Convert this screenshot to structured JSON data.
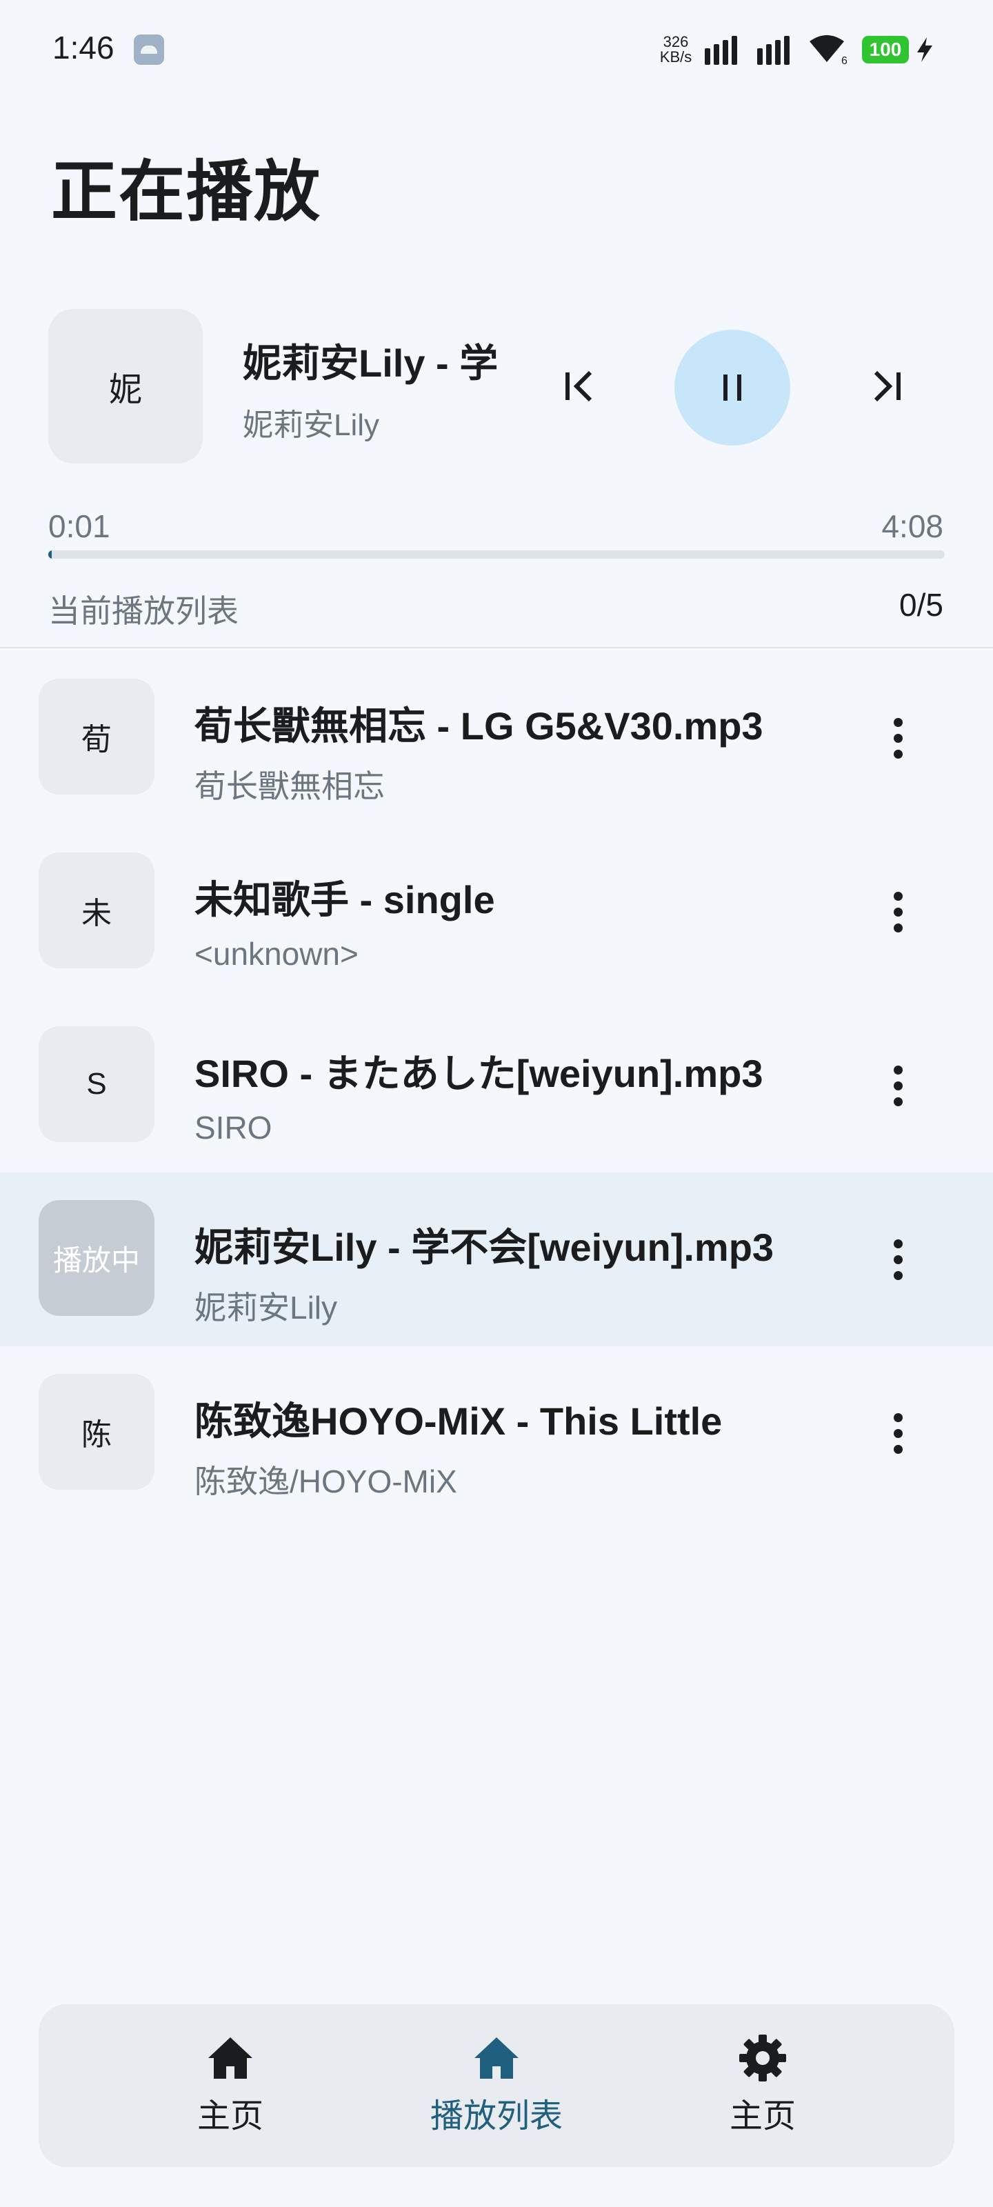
{
  "status_bar": {
    "time": "1:46",
    "net_speed_value": "326",
    "net_speed_unit": "KB/s",
    "wifi_badge": "6",
    "battery": "100"
  },
  "page": {
    "title": "正在播放"
  },
  "now_playing": {
    "art_char": "妮",
    "title": "妮莉安Lily - 学",
    "artist": "妮莉安Lily",
    "elapsed": "0:01",
    "total": "4:08",
    "progress_fraction": 0.004
  },
  "queue": {
    "label": "当前播放列表",
    "count": "0/5",
    "items": [
      {
        "art": "荀",
        "title": "荀长獸無相忘 - LG G5&V30.mp3",
        "subtitle": "荀长獸無相忘",
        "active": false
      },
      {
        "art": "未",
        "title": "未知歌手 - single",
        "subtitle": "<unknown>",
        "active": false
      },
      {
        "art": "S",
        "title": "SIRO - またあした[weiyun].mp3",
        "subtitle": "SIRO",
        "active": false
      },
      {
        "art": "播放中",
        "title": "妮莉安Lily - 学不会[weiyun].mp3",
        "subtitle": "妮莉安Lily",
        "active": true
      },
      {
        "art": "陈",
        "title": "陈致逸HOYO-MiX - This Little",
        "subtitle": "陈致逸/HOYO-MiX",
        "active": false
      }
    ]
  },
  "nav": {
    "items": [
      {
        "label": "主页",
        "icon": "home-icon",
        "selected": false
      },
      {
        "label": "播放列表",
        "icon": "home-icon",
        "selected": true
      },
      {
        "label": "主页",
        "icon": "gear-icon",
        "selected": false
      }
    ]
  },
  "colors": {
    "accent": "#205f7e",
    "pause_bg": "#c8e6fa",
    "active_row": "#e8f0f7",
    "battery": "#31c431"
  }
}
